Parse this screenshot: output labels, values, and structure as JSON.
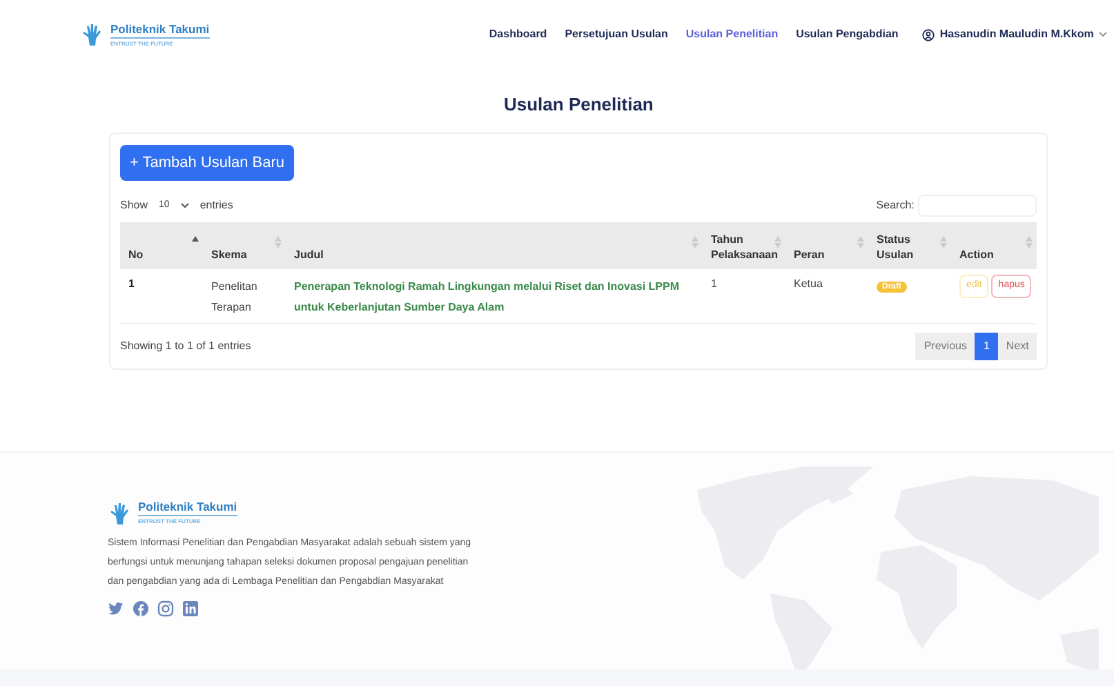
{
  "brand": {
    "name": "Politeknik Takumi",
    "tagline": "ENTRUST THE FUTURE"
  },
  "nav": [
    {
      "label": "Dashboard",
      "selected": false
    },
    {
      "label": "Persetujuan Usulan",
      "selected": false
    },
    {
      "label": "Usulan Penelitian",
      "selected": true
    },
    {
      "label": "Usulan Pengabdian",
      "selected": false
    }
  ],
  "user": {
    "name": "Hasanudin Mauludin M.Kkom"
  },
  "page_title": "Usulan Penelitian",
  "add_button": "+ Tambah Usulan Baru",
  "length": {
    "before": "Show",
    "value": "10",
    "after": "entries"
  },
  "search": {
    "label": "Search:"
  },
  "table": {
    "columns": [
      {
        "label": "No",
        "sorted": true
      },
      {
        "label": "Skema",
        "sorted": false
      },
      {
        "label": "Judul",
        "sorted": false
      },
      {
        "label": "Tahun Pelaksanaan",
        "sorted": false
      },
      {
        "label": "Peran",
        "sorted": false
      },
      {
        "label": "Status Usulan",
        "sorted": false
      },
      {
        "label": "Action",
        "sorted": false
      }
    ],
    "rows": [
      {
        "no": "1",
        "skema": "Penelitan Terapan",
        "judul": "Penerapan Teknologi Ramah Lingkungan melalui Riset dan Inovasi LPPM untuk Keberlanjutan Sumber Daya Alam",
        "tahun": "1",
        "peran": "Ketua",
        "status": "Draft",
        "actions": [
          "edit",
          "hapus"
        ]
      }
    ]
  },
  "info": "Showing 1 to 1 of 1 entries",
  "pagination": [
    {
      "label": "Previous",
      "selected": false
    },
    {
      "label": "1",
      "selected": true
    },
    {
      "label": "Next",
      "selected": false
    }
  ],
  "footer": {
    "brand": {
      "name": "Politeknik Takumi",
      "tagline": "ENTRUST THE FUTURE"
    },
    "description": "Sistem Informasi Penelitian dan Pengabdian Masyarakat adalah sebuah sistem yang berfungsi untuk menunjang tahapan seleksi dokumen proposal pengajuan penelitian dan pengabdian yang ada di Lembaga Penelitian dan Pengabdian Masyarakat",
    "social": [
      {
        "kind": "twitter"
      },
      {
        "kind": "facebook"
      },
      {
        "kind": "instagram"
      },
      {
        "kind": "linkedin"
      }
    ]
  }
}
